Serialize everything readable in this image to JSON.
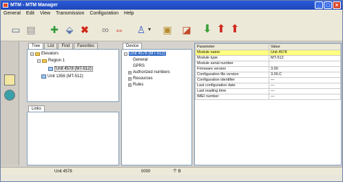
{
  "window": {
    "title": "MTM - MTM Manager"
  },
  "menu": [
    "General",
    "Edit",
    "View",
    "Transmission",
    "Configuration",
    "Help"
  ],
  "toolbar": {
    "icons": [
      "computer-icon",
      "clipboard-icon",
      "connect-icon",
      "import-icon",
      "delete-icon",
      "link-icon",
      "transfer-icon",
      "user-icon",
      "user-dropdown-icon",
      "calendar-icon",
      "chart-icon",
      "arrow-down-icon",
      "arrow-up-icon",
      "arrow-up-alt-icon"
    ]
  },
  "left_tabs": [
    "Tree",
    "List",
    "Find",
    "Favorites"
  ],
  "tree": {
    "root": "Elevators",
    "group": "Region 1",
    "items": [
      "Unit 4578 (MT-512)",
      "Unit 1356 (MT-512)"
    ]
  },
  "links_tab": "Links",
  "device_tab": "Device",
  "device_tree": {
    "root": "Unit 4578 (MT-512)",
    "children": [
      "General",
      "GPRS",
      "Authorized numbers",
      "Resources",
      "Rules"
    ]
  },
  "props": {
    "headers": [
      "Parameter",
      "Value"
    ],
    "rows": [
      [
        "Module name",
        "Unit 4578"
      ],
      [
        "Module type",
        "MT-512"
      ],
      [
        "Module serial number",
        ""
      ],
      [
        "Firmware version",
        "3.00"
      ],
      [
        "Configuration file version",
        "3.00.C"
      ],
      [
        "Configuration identifier",
        "—"
      ],
      [
        "Last configuration date",
        "—"
      ],
      [
        "Last reading time",
        "—"
      ],
      [
        "IMEI number",
        "—"
      ]
    ]
  },
  "status": {
    "unit": "Unit 4578",
    "code": "0000",
    "extra": "个 B"
  }
}
